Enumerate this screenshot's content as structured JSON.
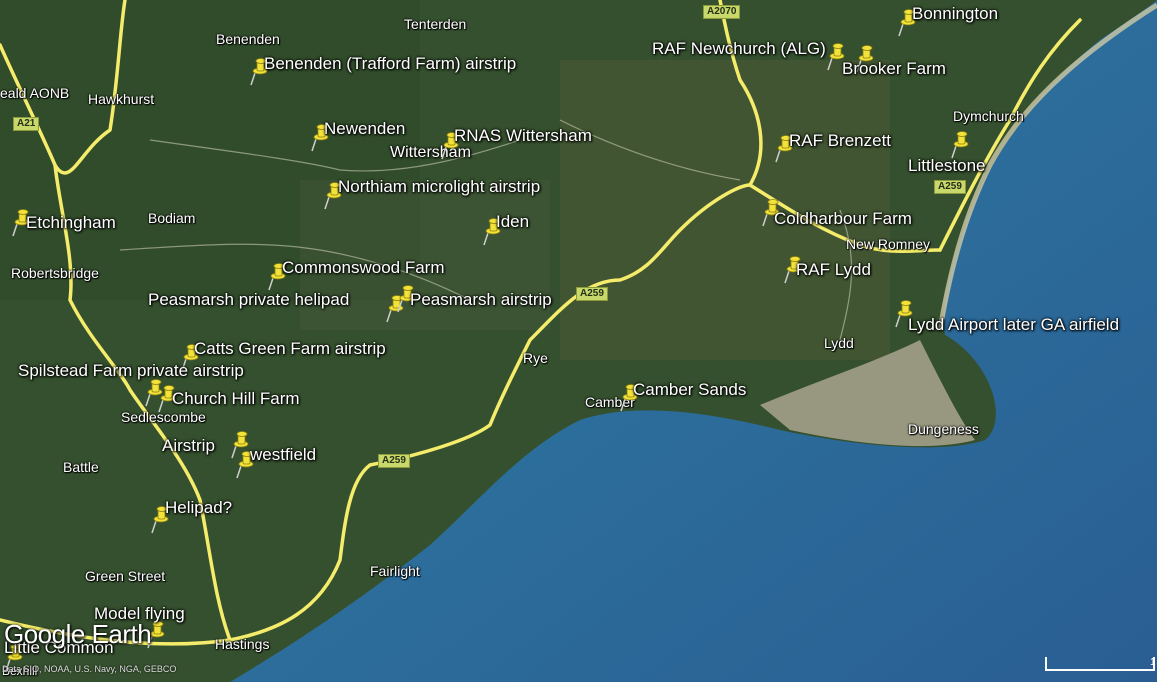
{
  "colors": {
    "land": "#33502f",
    "sea": "#2f6a9a",
    "road": "#f4ec6a",
    "pin": "#f2e23a"
  },
  "place_names": [
    "Tenterden",
    "Benenden",
    "eald AONB",
    "Hawkhurst",
    "Bodiam",
    "Robertsbridge",
    "Wittersham",
    "Dymchurch",
    "New Romney",
    "Lydd",
    "Rye",
    "Camber",
    "Sedlescombe",
    "Battle",
    "Green Street",
    "Fairlight",
    "Hastings",
    "Dungeness",
    "Bexhill"
  ],
  "road_labels": [
    "A2070",
    "A21",
    "A259",
    "A259",
    "A259",
    "A259"
  ],
  "pins": [
    {
      "label": "Bonnington",
      "icon": "pushpin-icon"
    },
    {
      "label": "RAF Newchurch (ALG)",
      "icon": "pushpin-icon"
    },
    {
      "label": "Brooker Farm",
      "icon": "pushpin-icon"
    },
    {
      "label": "Benenden (Trafford Farm) airstrip",
      "icon": "pushpin-icon"
    },
    {
      "label": "Newenden",
      "icon": "pushpin-icon"
    },
    {
      "label": "RNAS Wittersham",
      "icon": "pushpin-icon"
    },
    {
      "label": "RAF Brenzett",
      "icon": "pushpin-icon"
    },
    {
      "label": "Littlestone",
      "icon": "pushpin-icon"
    },
    {
      "label": "Northiam microlight airstrip",
      "icon": "pushpin-icon"
    },
    {
      "label": "Etchingham",
      "icon": "pushpin-icon"
    },
    {
      "label": "Iden",
      "icon": "pushpin-icon"
    },
    {
      "label": "Coldharbour Farm",
      "icon": "pushpin-icon"
    },
    {
      "label": "Commonswood Farm",
      "icon": "pushpin-icon"
    },
    {
      "label": "RAF Lydd",
      "icon": "pushpin-icon"
    },
    {
      "label": "Peasmarsh private helipad",
      "icon": "pushpin-icon"
    },
    {
      "label": "Peasmarsh airstrip",
      "icon": "pushpin-icon"
    },
    {
      "label": "Lydd Airport later GA airfield",
      "icon": "pushpin-icon"
    },
    {
      "label": "Catts Green Farm airstrip",
      "icon": "pushpin-icon"
    },
    {
      "label": "Spilstead Farm private airstrip",
      "icon": "pushpin-icon"
    },
    {
      "label": "Church Hill Farm",
      "icon": "pushpin-icon"
    },
    {
      "label": "Camber Sands",
      "icon": "pushpin-icon"
    },
    {
      "label": "Airstrip",
      "icon": "pushpin-icon"
    },
    {
      "label": "westfield",
      "icon": "pushpin-icon"
    },
    {
      "label": "Helipad?",
      "icon": "pushpin-icon"
    },
    {
      "label": "Model flying",
      "icon": "pushpin-icon"
    },
    {
      "label": "Little Common",
      "icon": "pushpin-icon"
    }
  ],
  "logo": "Google Earth",
  "credits": "Data SIO, NOAA, U.S. Navy, NGA, GEBCO",
  "scale_label": "1"
}
